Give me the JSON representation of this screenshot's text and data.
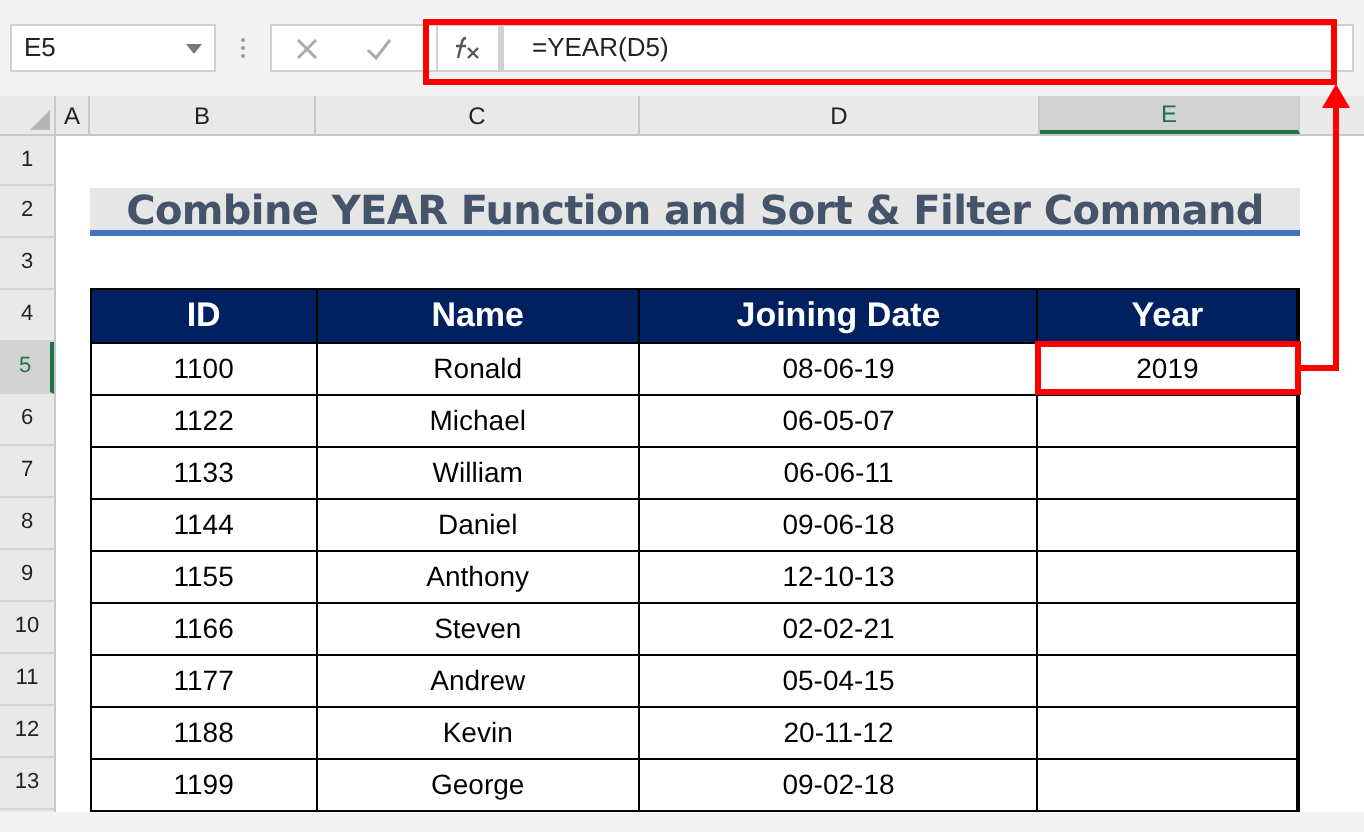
{
  "name_box": "E5",
  "formula": "=YEAR(D5)",
  "columns": [
    {
      "label": "A",
      "selected": false
    },
    {
      "label": "B",
      "selected": false
    },
    {
      "label": "C",
      "selected": false
    },
    {
      "label": "D",
      "selected": false
    },
    {
      "label": "E",
      "selected": true
    }
  ],
  "row_numbers": [
    {
      "label": "1",
      "selected": false
    },
    {
      "label": "2",
      "selected": false
    },
    {
      "label": "3",
      "selected": false
    },
    {
      "label": "4",
      "selected": false
    },
    {
      "label": "5",
      "selected": true
    },
    {
      "label": "6",
      "selected": false
    },
    {
      "label": "7",
      "selected": false
    },
    {
      "label": "8",
      "selected": false
    },
    {
      "label": "9",
      "selected": false
    },
    {
      "label": "10",
      "selected": false
    },
    {
      "label": "11",
      "selected": false
    },
    {
      "label": "12",
      "selected": false
    },
    {
      "label": "13",
      "selected": false
    }
  ],
  "title": "Combine YEAR Function and Sort & Filter Command",
  "table": {
    "columns": [
      "ID",
      "Name",
      "Joining Date",
      "Year"
    ],
    "rows": [
      [
        "1100",
        "Ronald",
        "08-06-19",
        "2019"
      ],
      [
        "1122",
        "Michael",
        "06-05-07",
        ""
      ],
      [
        "1133",
        "William",
        "06-06-11",
        ""
      ],
      [
        "1144",
        "Daniel",
        "09-06-18",
        ""
      ],
      [
        "1155",
        "Anthony",
        "12-10-13",
        ""
      ],
      [
        "1166",
        "Steven",
        "02-02-21",
        ""
      ],
      [
        "1177",
        "Andrew",
        "05-04-15",
        ""
      ],
      [
        "1188",
        "Kevin",
        "20-11-12",
        ""
      ],
      [
        "1199",
        "George",
        "09-02-18",
        ""
      ]
    ]
  }
}
